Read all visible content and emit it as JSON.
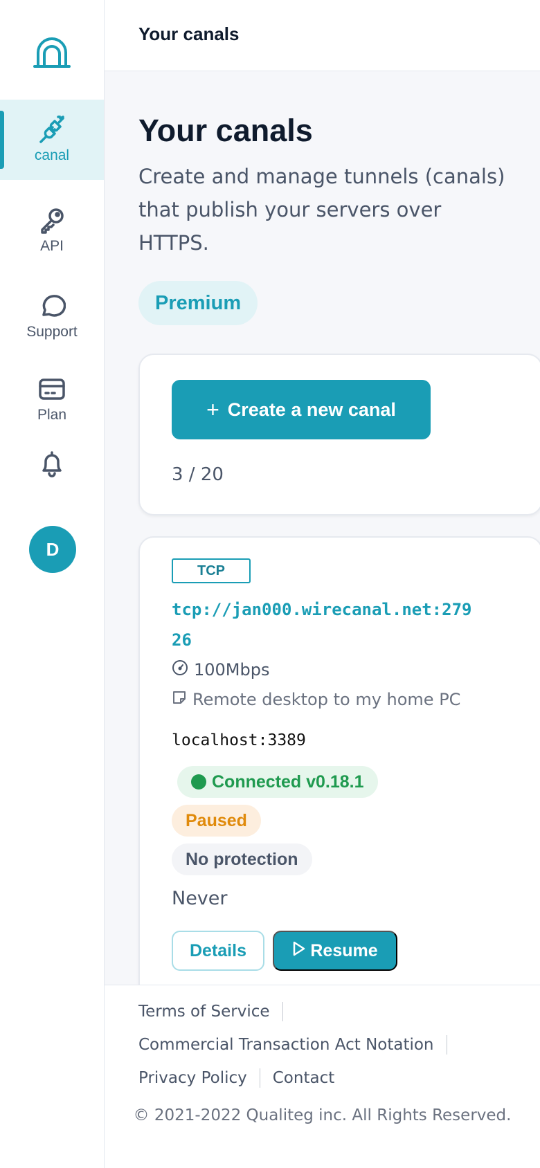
{
  "sidebar": {
    "logo_icon": "tunnel-arch-icon",
    "items": [
      {
        "label": "canal",
        "icon": "plug-icon",
        "active": true
      },
      {
        "label": "API",
        "icon": "key-icon"
      },
      {
        "label": "Support",
        "icon": "chat-bubble-icon"
      },
      {
        "label": "Plan",
        "icon": "credit-card-icon"
      },
      {
        "label": "",
        "icon": "bell-icon"
      }
    ],
    "avatar_initial": "D"
  },
  "topbar": {
    "title": "Your canals"
  },
  "main": {
    "title": "Your canals",
    "description": "Create and manage tunnels (canals) that publish your servers over HTTPS.",
    "plan_badge": "Premium",
    "create_button": "Create a new canal",
    "quota": "3 / 20"
  },
  "canal": {
    "type": "TCP",
    "url": "tcp://jan000.wirecanal.net:27926",
    "speed": "100Mbps",
    "memo": "Remote desktop to my home PC",
    "local_address": "localhost:3389",
    "status": "Connected v0.18.1",
    "state": "Paused",
    "protection": "No protection",
    "last_access": "Never",
    "details_button": "Details",
    "resume_button": "Resume"
  },
  "footer": {
    "links": [
      "Terms of Service",
      "Commercial Transaction Act Notation",
      "Privacy Policy",
      "Contact"
    ],
    "copyright": "© 2021-2022 Qualiteg inc. All Rights Reserved."
  },
  "colors": {
    "accent": "#1a9db5",
    "success": "#1f9a4f",
    "warning": "#e08a0b",
    "text": "#0f1b2d"
  }
}
